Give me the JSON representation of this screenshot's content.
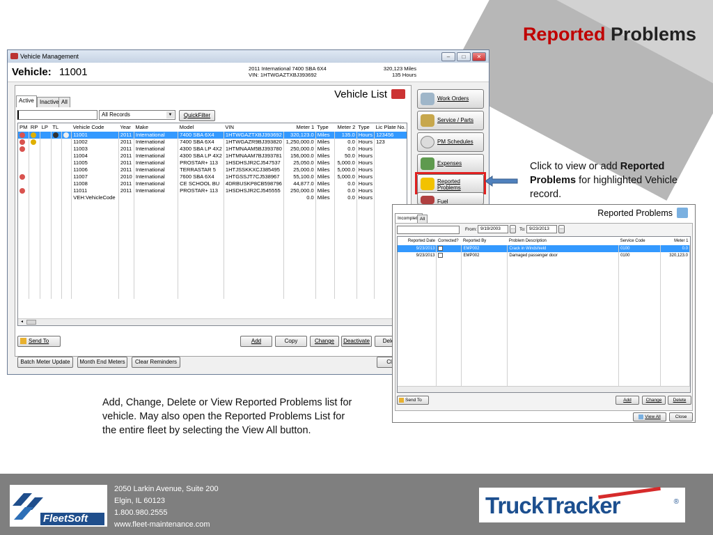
{
  "slide": {
    "title_accent": "Reported",
    "title_rest": " Problems",
    "caption_right_pre": "Click to view or add ",
    "caption_right_bold": "Reported Problems",
    "caption_right_post": " for highlighted Vehicle record.",
    "caption_bottom": "Add, Change, Delete or View Reported Problems list for vehicle.  May also open the Reported Problems List for the entire fleet by selecting the View All button."
  },
  "footer": {
    "address_line1": "2050 Larkin Avenue, Suite 200",
    "address_line2": "Elgin, IL  60123",
    "phone": "1.800.980.2555",
    "website": "www.fleet-maintenance.com",
    "fleetsoft_logo": "FleetSoft",
    "trucktracker_logo": "TruckTracker",
    "registered_mark": "®"
  },
  "vehicle_window": {
    "title": "Vehicle Management",
    "vehicle_label": "Vehicle:",
    "vehicle_code": "11001",
    "vehicle_desc": "2011 International 7400 SBA 6X4",
    "vin_line": "VIN: 1HTWGAZTXBJ393692",
    "miles": "320,123 Miles",
    "hours": "135 Hours",
    "list_title": "Vehicle List",
    "tabs": [
      "Active",
      "Inactive",
      "All"
    ],
    "search_value": "",
    "filter_value": "All Records",
    "quickfilter_label": "QuickFilter",
    "columns": [
      "PM",
      "RP",
      "LP",
      "TL",
      "",
      "Vehicle Code",
      "Year",
      "Make",
      "Model",
      "VIN",
      "Meter 1",
      "Type",
      "Meter 2",
      "Type",
      "Lic Plate No."
    ],
    "rows": [
      {
        "pm": true,
        "rp": true,
        "lp": false,
        "tl": true,
        "code": "11001",
        "year": "2011",
        "make": "International",
        "model": "7400 SBA 6X4",
        "vin": "1HTWGAZTXBJ393692",
        "m1": "320,123.0",
        "t1": "Miles",
        "m2": "135.0",
        "t2": "Hours",
        "plate": "123456"
      },
      {
        "pm": true,
        "rp": true,
        "lp": false,
        "tl": false,
        "code": "11002",
        "year": "2011",
        "make": "International",
        "model": "7400 SBA 6X4",
        "vin": "1HTWGAZR9BJ393820",
        "m1": "1,250,000.0",
        "t1": "Miles",
        "m2": "0.0",
        "t2": "Hours",
        "plate": "123"
      },
      {
        "pm": true,
        "rp": false,
        "lp": false,
        "tl": false,
        "code": "11003",
        "year": "2011",
        "make": "International",
        "model": "4300 SBA LP 4X2",
        "vin": "1HTMNAAM5BJ393780",
        "m1": "250,000.0",
        "t1": "Miles",
        "m2": "0.0",
        "t2": "Hours",
        "plate": ""
      },
      {
        "pm": false,
        "rp": false,
        "lp": false,
        "tl": false,
        "code": "11004",
        "year": "2011",
        "make": "International",
        "model": "4300 SBA LP 4X2",
        "vin": "1HTMNAAM7BJ393781",
        "m1": "156,000.0",
        "t1": "Miles",
        "m2": "50.0",
        "t2": "Hours",
        "plate": ""
      },
      {
        "pm": false,
        "rp": false,
        "lp": false,
        "tl": false,
        "code": "11005",
        "year": "2011",
        "make": "International",
        "model": "PROSTAR+ 113",
        "vin": "1HSDHSJR2CJ547537",
        "m1": "25,050.0",
        "t1": "Miles",
        "m2": "5,000.0",
        "t2": "Hours",
        "plate": ""
      },
      {
        "pm": false,
        "rp": false,
        "lp": false,
        "tl": false,
        "code": "11006",
        "year": "2011",
        "make": "International",
        "model": "TERRASTAR 5",
        "vin": "1HTJSSKKXCJ385495",
        "m1": "25,000.0",
        "t1": "Miles",
        "m2": "5,000.0",
        "t2": "Hours",
        "plate": ""
      },
      {
        "pm": true,
        "rp": false,
        "lp": false,
        "tl": false,
        "code": "11007",
        "year": "2010",
        "make": "International",
        "model": "7600 SBA 6X4",
        "vin": "1HTGSSJT7CJ538967",
        "m1": "55,100.0",
        "t1": "Miles",
        "m2": "5,000.0",
        "t2": "Hours",
        "plate": ""
      },
      {
        "pm": false,
        "rp": false,
        "lp": false,
        "tl": false,
        "code": "11008",
        "year": "2011",
        "make": "International",
        "model": "CE SCHOOL BU",
        "vin": "4DRBUSKP8CB598796",
        "m1": "44,877.0",
        "t1": "Miles",
        "m2": "0.0",
        "t2": "Hours",
        "plate": ""
      },
      {
        "pm": true,
        "rp": false,
        "lp": false,
        "tl": false,
        "code": "11011",
        "year": "2011",
        "make": "International",
        "model": "PROSTAR+ 113",
        "vin": "1HSDHSJR2CJ545555",
        "m1": "250,000.0",
        "t1": "Miles",
        "m2": "0.0",
        "t2": "Hours",
        "plate": ""
      },
      {
        "pm": false,
        "rp": false,
        "lp": false,
        "tl": false,
        "code": "VEH:VehicleCode",
        "year": "",
        "make": "",
        "model": "",
        "vin": "",
        "m1": "0.0",
        "t1": "Miles",
        "m2": "0.0",
        "t2": "Hours",
        "plate": ""
      }
    ],
    "buttons": {
      "send_to": "Send To",
      "add": "Add",
      "copy": "Copy",
      "change": "Change",
      "deactivate": "Deactivate",
      "delete": "Dele",
      "batch_meter": "Batch Meter Update",
      "month_end": "Month End Meters",
      "clear_reminders": "Clear Reminders",
      "close": "Cl"
    },
    "nav": [
      "Work Orders",
      "Service / Parts",
      "PM Schedules",
      "Expenses",
      "Reported Problems",
      "Fuel"
    ]
  },
  "rp_window": {
    "title": "Reported Problems",
    "tabs": [
      "Incomplete",
      "All"
    ],
    "from_label": "From:",
    "from_value": "9/19/2003",
    "to_label": "To:",
    "to_value": "9/23/2013",
    "columns": [
      "Reported Date",
      "Corrected?",
      "Reported By",
      "Problem Description",
      "Service Code",
      "Meter 1"
    ],
    "rows": [
      {
        "date": "9/23/2013",
        "corrected": false,
        "by": "EMP002",
        "desc": "Crack in Windshield",
        "code": "0100",
        "meter": "0.0"
      },
      {
        "date": "9/23/2013",
        "corrected": false,
        "by": "EMP002",
        "desc": "Damaged passenger door",
        "code": "0100",
        "meter": "320,123.0"
      }
    ],
    "buttons": {
      "send_to": "Send To",
      "add": "Add",
      "change": "Change",
      "delete": "Delete",
      "view_all": "View All",
      "close": "Close"
    }
  }
}
